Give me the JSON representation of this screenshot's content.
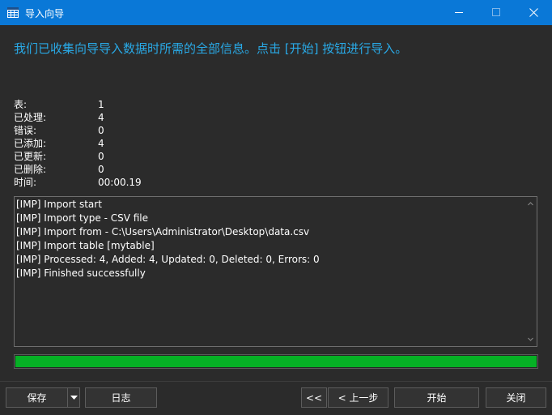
{
  "window": {
    "title": "导入向导",
    "icon": "table-grid-icon",
    "controls": [
      "minimize",
      "maximize",
      "close"
    ]
  },
  "headline": "我们已收集向导导入数据时所需的全部信息。点击 [开始] 按钮进行导入。",
  "stats": [
    {
      "label": "表:",
      "value": "1"
    },
    {
      "label": "已处理:",
      "value": "4"
    },
    {
      "label": "错误:",
      "value": "0"
    },
    {
      "label": "已添加:",
      "value": "4"
    },
    {
      "label": "已更新:",
      "value": "0"
    },
    {
      "label": "已删除:",
      "value": "0"
    },
    {
      "label": "时间:",
      "value": "00:00.19"
    }
  ],
  "log": [
    "[IMP] Import start",
    "[IMP] Import type - CSV file",
    "[IMP] Import from - C:\\Users\\Administrator\\Desktop\\data.csv",
    "[IMP] Import table [mytable]",
    "[IMP] Processed: 4, Added: 4, Updated: 0, Deleted: 0, Errors: 0",
    "[IMP] Finished successfully"
  ],
  "progress": {
    "fraction": 1.0,
    "color": "#06b025"
  },
  "buttons": {
    "save": "保存",
    "log": "日志",
    "first": "<<",
    "prev": "< 上一步",
    "start": "开始",
    "close": "关闭"
  },
  "colors": {
    "titlebar": "#0a78d7",
    "headline": "#29a9e6",
    "background": "#2b2b2b"
  }
}
